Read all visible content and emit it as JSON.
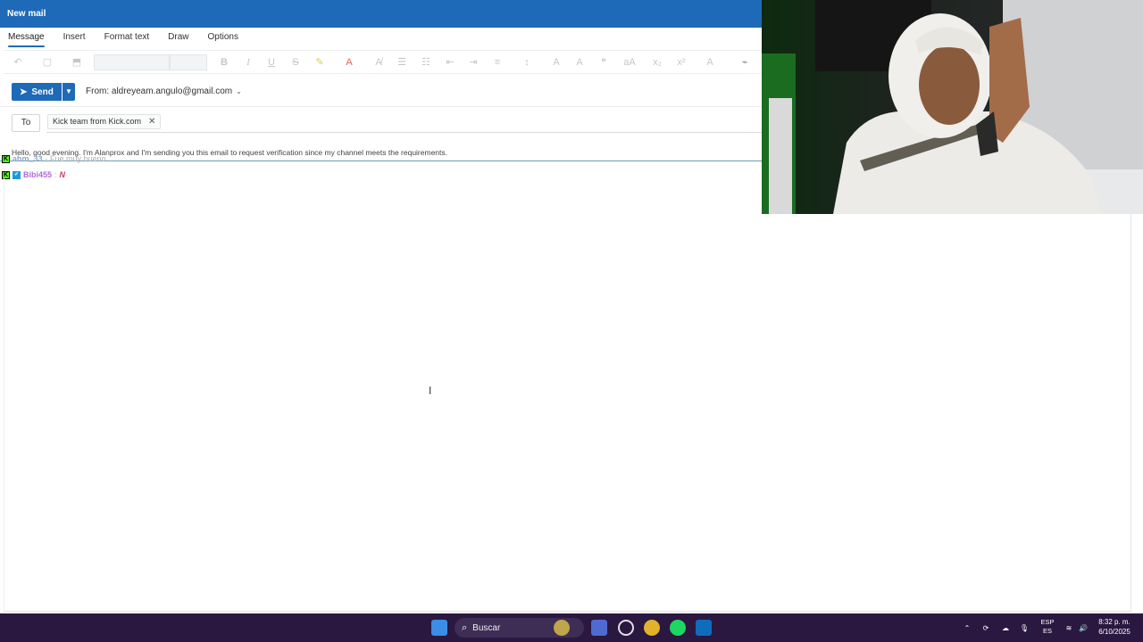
{
  "window": {
    "title": "New mail"
  },
  "tabs": [
    {
      "label": "Message",
      "active": true
    },
    {
      "label": "Insert"
    },
    {
      "label": "Format text"
    },
    {
      "label": "Draw"
    },
    {
      "label": "Options"
    }
  ],
  "ribbon": {
    "bold": "B",
    "italic": "I",
    "underline": "U",
    "strike": "S",
    "subscript": "x₂",
    "superscript": "x²",
    "font_size_icon": "aA"
  },
  "compose": {
    "send_label": "Send",
    "from_label": "From: aldreyeam.angulo@gmail.com",
    "to_button": "To",
    "recipient": "Kick team from Kick.com",
    "body": "Hello, good evening. I'm Alanprox and I'm sending you this email to request verification since my channel meets the requirements."
  },
  "chat": [
    {
      "user": "ahm_33",
      "message": "- Fue muy bueno"
    },
    {
      "user": "Bibi455",
      "sep": ":",
      "message": "N"
    }
  ],
  "taskbar": {
    "search_label": "Buscar",
    "lang_top": "ESP",
    "lang_bottom": "ES",
    "time": "8:32 p. m.",
    "date": "6/10/2025"
  },
  "colors": {
    "accent": "#1e6ab8",
    "taskbar": "#2a1840",
    "kick_green": "#53fc18"
  }
}
